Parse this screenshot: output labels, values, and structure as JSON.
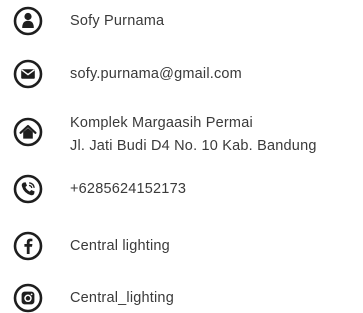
{
  "contact": {
    "items": [
      {
        "id": "name",
        "icon": "user-icon",
        "lines": [
          "Sofy Purnama"
        ]
      },
      {
        "id": "email",
        "icon": "envelope-icon",
        "lines": [
          "sofy.purnama@gmail.com"
        ]
      },
      {
        "id": "address",
        "icon": "home-icon",
        "lines": [
          "Komplek Margaasih Permai",
          "Jl. Jati Budi D4 No. 10 Kab. Bandung"
        ]
      },
      {
        "id": "phone",
        "icon": "phone-icon",
        "lines": [
          "+6285624152173"
        ]
      },
      {
        "id": "facebook",
        "icon": "facebook-icon",
        "lines": [
          "Central lighting"
        ]
      },
      {
        "id": "instagram",
        "icon": "instagram-icon",
        "lines": [
          "Central_lighting"
        ]
      }
    ]
  },
  "colors": {
    "icon": "#1e1e1e",
    "text": "#3a3a3a",
    "background": "#ffffff"
  }
}
